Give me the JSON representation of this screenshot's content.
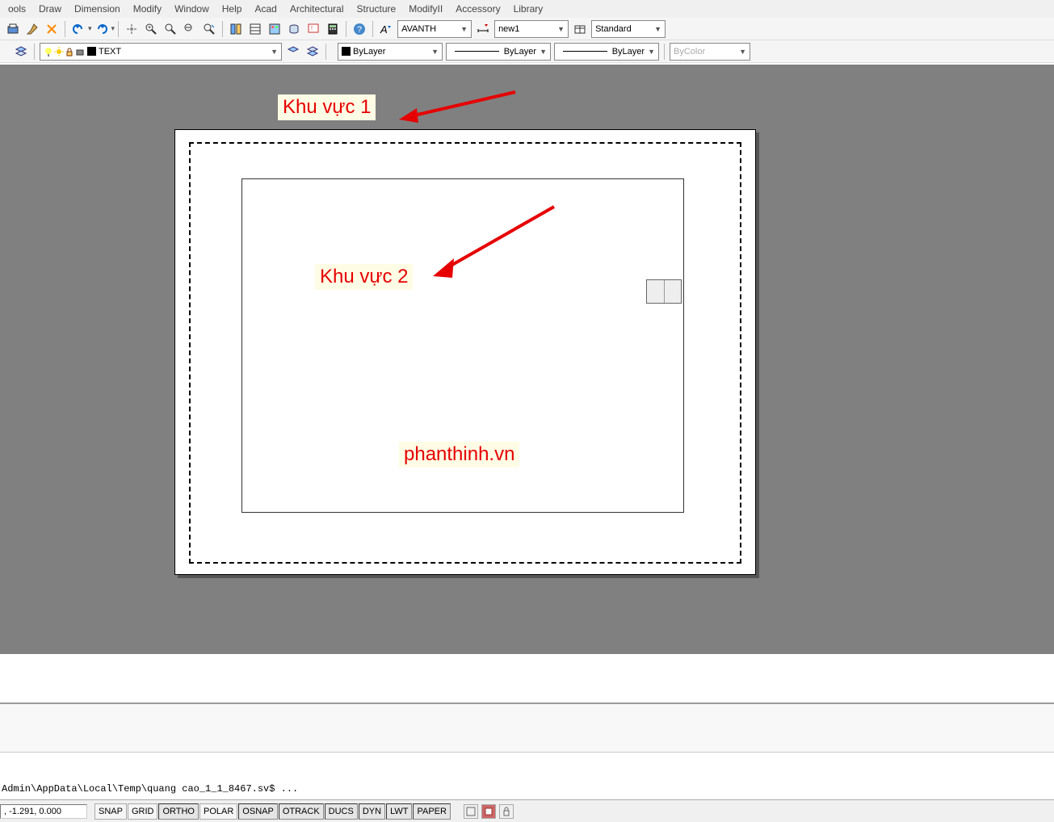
{
  "menus": [
    "ools",
    "Draw",
    "Dimension",
    "Modify",
    "Window",
    "Help",
    "Acad",
    "Architectural",
    "Structure",
    "ModifyII",
    "Accessory",
    "Library"
  ],
  "toolbar": {
    "style_dropdown": "AVANTH",
    "dim_dropdown": "new1",
    "table_dropdown": "Standard",
    "layer_value": "TEXT",
    "color_dropdown": "ByLayer",
    "linetype_dropdown": "ByLayer",
    "lineweight_dropdown": "ByLayer",
    "plotstyle_dropdown": "ByColor"
  },
  "canvas": {
    "annotation1": "Khu vực 1",
    "annotation2": "Khu vực 2",
    "watermark": "phanthinh.vn"
  },
  "command": {
    "line": "Admin\\AppData\\Local\\Temp\\quang cao_1_1_8467.sv$ ..."
  },
  "status": {
    "coords": ", -1.291, 0.000",
    "toggles": [
      "SNAP",
      "GRID",
      "ORTHO",
      "POLAR",
      "OSNAP",
      "OTRACK",
      "DUCS",
      "DYN",
      "LWT",
      "PAPER"
    ]
  },
  "arrow_char": "▼"
}
